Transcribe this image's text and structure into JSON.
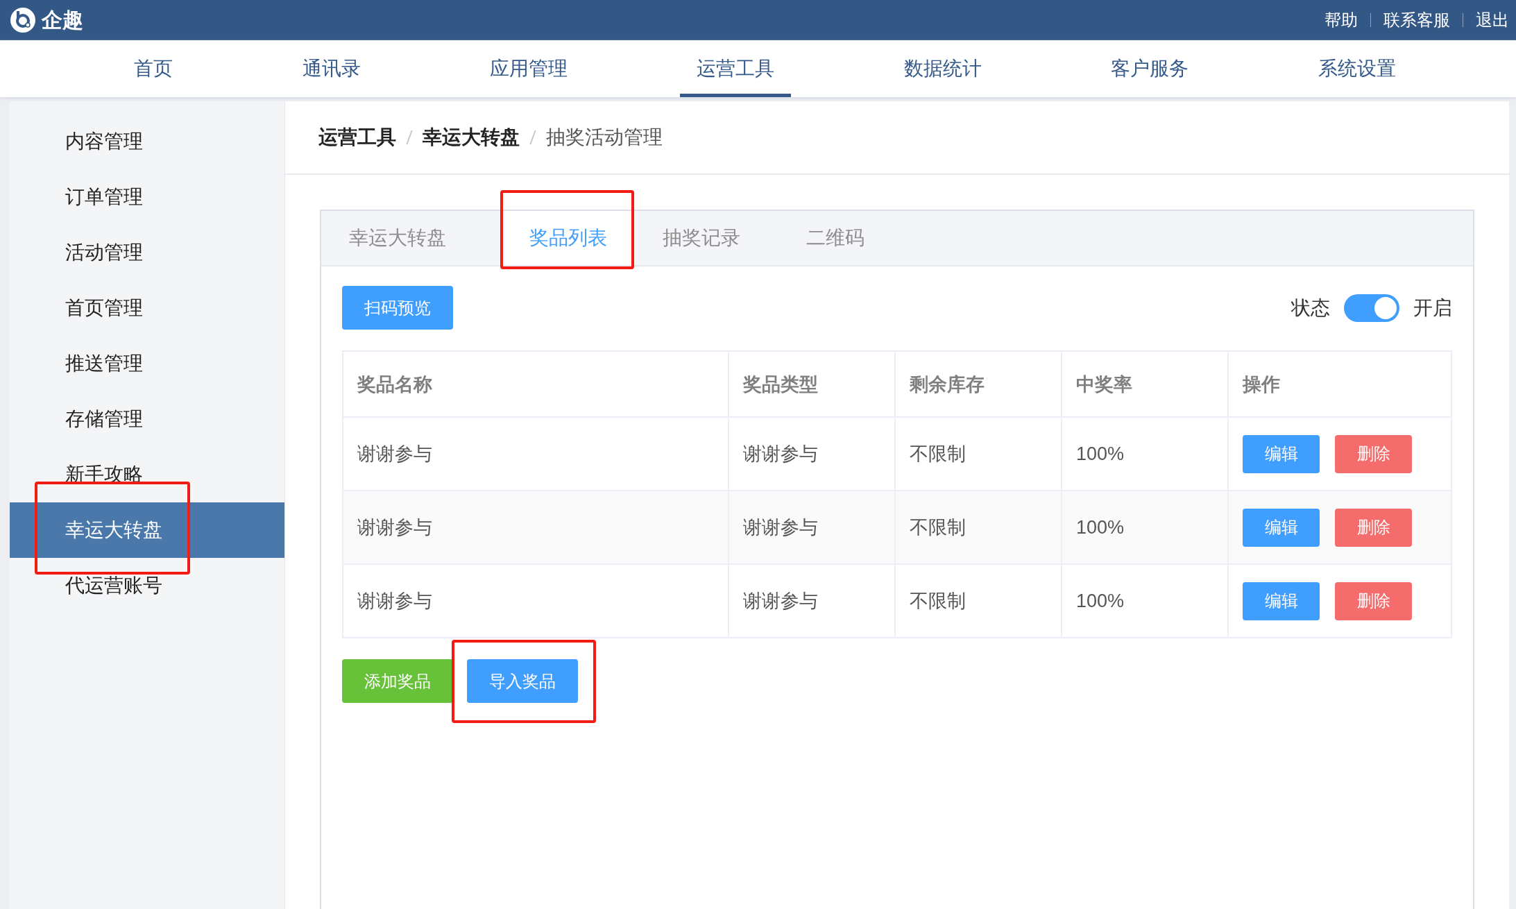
{
  "header": {
    "logo_text": "企趣",
    "links": [
      "帮助",
      "联系客服",
      "退出"
    ]
  },
  "nav": [
    {
      "label": "首页",
      "selected": false
    },
    {
      "label": "通讯录",
      "selected": false
    },
    {
      "label": "应用管理",
      "selected": false
    },
    {
      "label": "运营工具",
      "selected": true
    },
    {
      "label": "数据统计",
      "selected": false
    },
    {
      "label": "客户服务",
      "selected": false
    },
    {
      "label": "系统设置",
      "selected": false
    }
  ],
  "sidebar": {
    "items": [
      {
        "label": "内容管理",
        "selected": false,
        "highlighted": false
      },
      {
        "label": "订单管理",
        "selected": false,
        "highlighted": false
      },
      {
        "label": "活动管理",
        "selected": false,
        "highlighted": false
      },
      {
        "label": "首页管理",
        "selected": false,
        "highlighted": false
      },
      {
        "label": "推送管理",
        "selected": false,
        "highlighted": false
      },
      {
        "label": "存储管理",
        "selected": false,
        "highlighted": false
      },
      {
        "label": "新手攻略",
        "selected": false,
        "highlighted": false
      },
      {
        "label": "幸运大转盘",
        "selected": true,
        "highlighted": true
      },
      {
        "label": "代运营账号",
        "selected": false,
        "highlighted": false
      }
    ]
  },
  "breadcrumb": [
    {
      "label": "运营工具",
      "current": false
    },
    {
      "label": "幸运大转盘",
      "current": false
    },
    {
      "label": "抽奖活动管理",
      "current": true
    }
  ],
  "tabs": [
    {
      "label": "幸运大转盘",
      "selected": false,
      "highlighted": false
    },
    {
      "label": "奖品列表",
      "selected": true,
      "highlighted": true
    },
    {
      "label": "抽奖记录",
      "selected": false,
      "highlighted": false
    },
    {
      "label": "二维码",
      "selected": false,
      "highlighted": false
    }
  ],
  "preview_button": "扫码预览",
  "status": {
    "label": "状态",
    "on": true,
    "value": "开启"
  },
  "table": {
    "columns": [
      "奖品名称",
      "奖品类型",
      "剩余库存",
      "中奖率",
      "操作"
    ],
    "rows": [
      {
        "cells": [
          "谢谢参与",
          "谢谢参与",
          "不限制",
          "100%"
        ],
        "actions": [
          "编辑",
          "删除"
        ]
      },
      {
        "cells": [
          "谢谢参与",
          "谢谢参与",
          "不限制",
          "100%"
        ],
        "actions": [
          "编辑",
          "删除"
        ]
      },
      {
        "cells": [
          "谢谢参与",
          "谢谢参与",
          "不限制",
          "100%"
        ],
        "actions": [
          "编辑",
          "删除"
        ]
      }
    ]
  },
  "bottom_buttons": [
    {
      "label": "添加奖品",
      "kind": "success",
      "highlighted": false
    },
    {
      "label": "导入奖品",
      "kind": "primary",
      "highlighted": true
    }
  ]
}
